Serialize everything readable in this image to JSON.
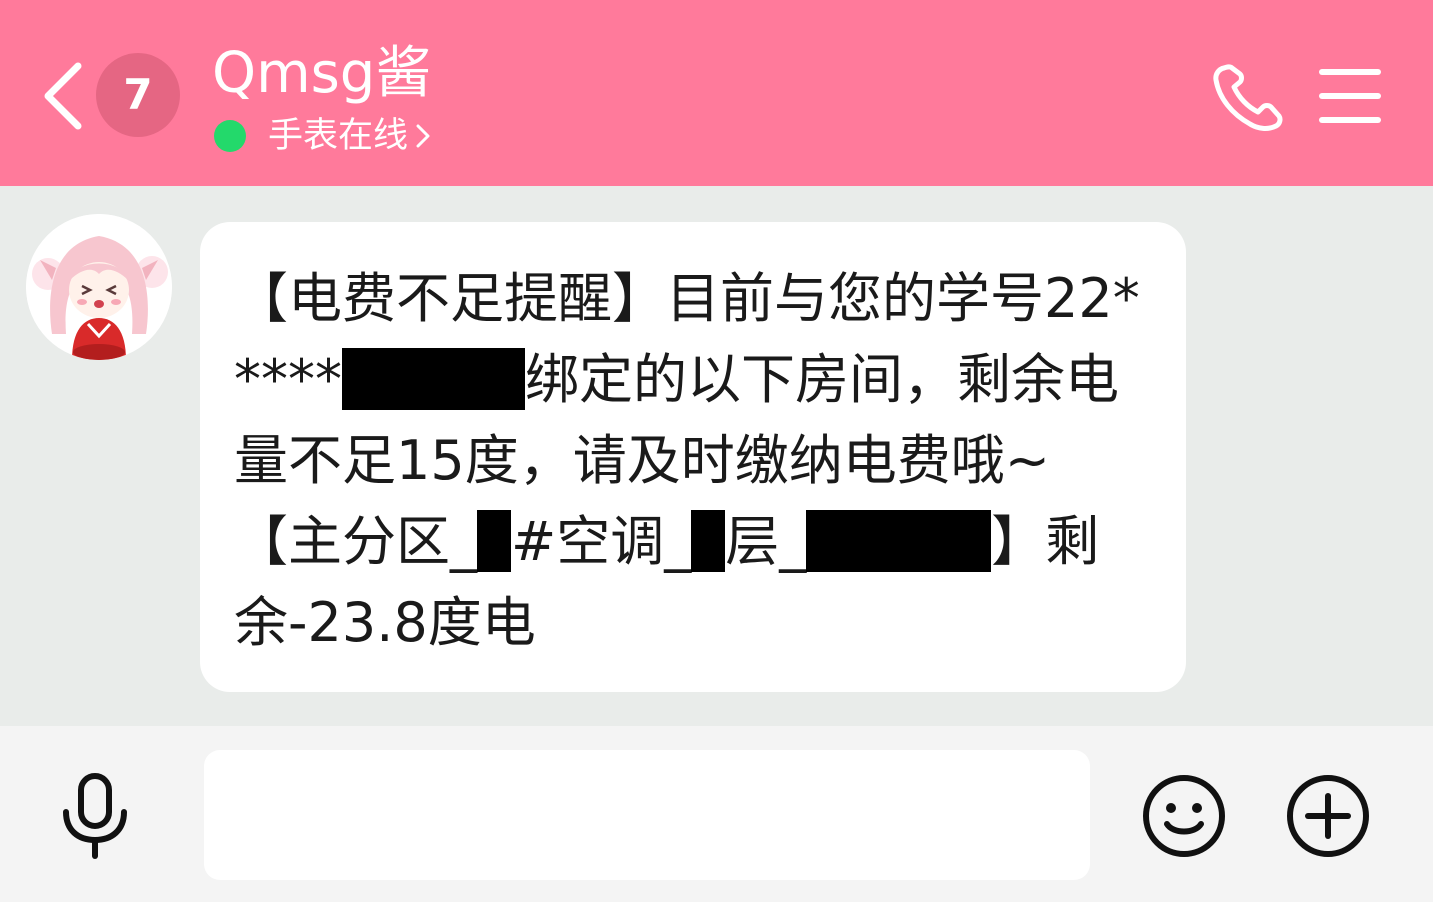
{
  "header": {
    "unread_count": "7",
    "contact_name": "Qmsg酱",
    "status": "手表在线",
    "online_color": "#23d96b",
    "bar_color": "#ff7a9b"
  },
  "message": {
    "p1": "【电费不足提醒】目前与您的学号22*****",
    "p2": "绑定的以下房间，剩余电量不足15度，请及时缴纳电费哦~　【主分区_",
    "p3": "#空调_",
    "p4": "层_",
    "p5": "】剩余-23.8度电"
  },
  "input": {
    "placeholder": ""
  },
  "icons": {
    "back": "chevron-left-icon",
    "call": "phone-icon",
    "menu": "hamburger-menu-icon",
    "mic": "microphone-icon",
    "emoji": "smiley-icon",
    "plus": "plus-circle-icon"
  }
}
